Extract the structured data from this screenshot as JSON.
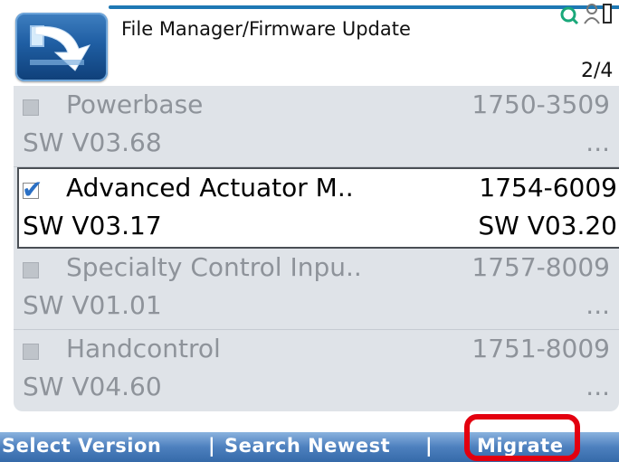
{
  "header": {
    "title": "File Manager/Firmware Update",
    "page_indicator": "2/4",
    "app_icon": "arrow-into-box-icon",
    "status_icons": [
      "search-icon",
      "user-icon"
    ]
  },
  "items": [
    {
      "name": "Powerbase",
      "part_number": "1750-3509",
      "version": "SW V03.68",
      "new_version": "...",
      "checked": false
    },
    {
      "name": "Advanced Actuator M..",
      "part_number": "1754-6009",
      "version": "SW V03.17",
      "new_version": "SW V03.20",
      "checked": true
    },
    {
      "name": "Specialty Control Inpu..",
      "part_number": "1757-8009",
      "version": "SW V01.01",
      "new_version": "...",
      "checked": false
    },
    {
      "name": "Handcontrol",
      "part_number": "1751-8009",
      "version": "SW V04.60",
      "new_version": "...",
      "checked": false
    }
  ],
  "softkeys": {
    "select_version": "Select Version",
    "separator": "|",
    "search_newest": "Search Newest",
    "migrate": "Migrate"
  },
  "colors": {
    "selection_checkmark": "#2a6fc4",
    "highlight_box": "#e3000f",
    "softkey_bar": "#4d80be"
  }
}
